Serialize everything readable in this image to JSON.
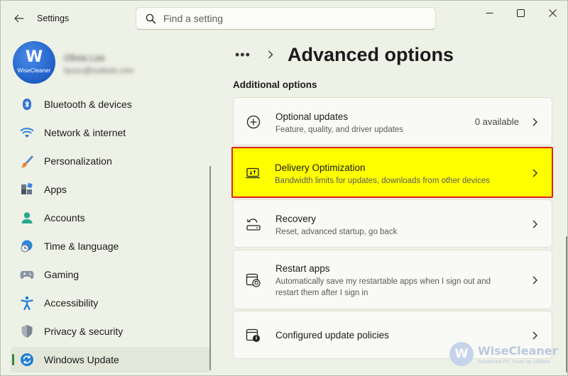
{
  "window": {
    "app_title": "Settings"
  },
  "search": {
    "placeholder": "Find a setting"
  },
  "profile": {
    "avatar_letter": "W",
    "avatar_brand": "WiseCleaner",
    "name": "Olivia Lee",
    "email": "liyuxu@outlook.com"
  },
  "sidebar": {
    "items": [
      {
        "label": "Bluetooth & devices",
        "icon": "bluetooth-icon",
        "active": false
      },
      {
        "label": "Network & internet",
        "icon": "wifi-icon",
        "active": false
      },
      {
        "label": "Personalization",
        "icon": "brush-icon",
        "active": false
      },
      {
        "label": "Apps",
        "icon": "apps-icon",
        "active": false
      },
      {
        "label": "Accounts",
        "icon": "person-icon",
        "active": false
      },
      {
        "label": "Time & language",
        "icon": "globe-clock-icon",
        "active": false
      },
      {
        "label": "Gaming",
        "icon": "gamepad-icon",
        "active": false
      },
      {
        "label": "Accessibility",
        "icon": "accessibility-icon",
        "active": false
      },
      {
        "label": "Privacy & security",
        "icon": "shield-icon",
        "active": false
      },
      {
        "label": "Windows Update",
        "icon": "update-icon",
        "active": true
      }
    ]
  },
  "main": {
    "breadcrumb_ellipsis": "•••",
    "page_title": "Advanced options",
    "section_heading": "Additional options",
    "cards": [
      {
        "title": "Optional updates",
        "desc": "Feature, quality, and driver updates",
        "status": "0 available",
        "icon": "plus-circle-icon"
      },
      {
        "title": "Delivery Optimization",
        "desc": "Bandwidth limits for updates, downloads from other devices",
        "icon": "delivery-optimization-icon",
        "highlighted": true
      },
      {
        "title": "Recovery",
        "desc": "Reset, advanced startup, go back",
        "icon": "recovery-icon"
      },
      {
        "title": "Restart apps",
        "desc_line1": "Automatically save my restartable apps when I sign out and",
        "desc_line2": "restart them after I sign in",
        "icon": "restart-apps-icon"
      },
      {
        "title": "Configured update policies",
        "icon": "policy-icon"
      }
    ]
  },
  "watermark": {
    "logo_letter": "W",
    "name": "WiseCleaner",
    "tagline": "Advanced PC Tune-up Utilities"
  },
  "colors": {
    "background": "#eef1e6",
    "card": "#f9faf5",
    "highlight": "#ffff00",
    "highlight_border": "#e02020",
    "active_indicator": "#2d8a3a",
    "accent": "#1f5fc7"
  }
}
